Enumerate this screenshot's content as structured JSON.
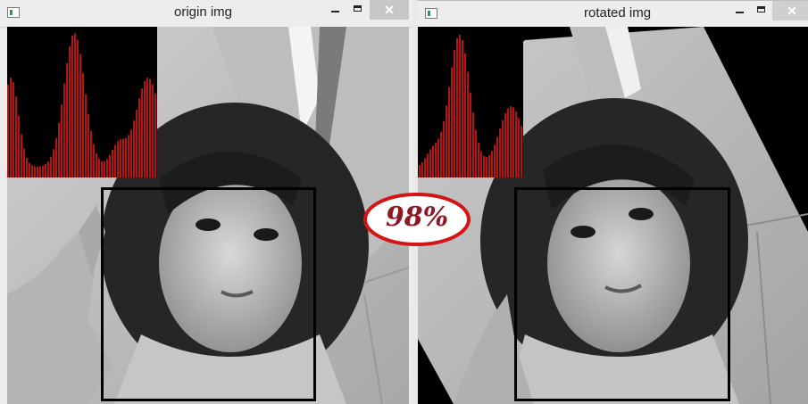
{
  "windows": {
    "left": {
      "title": "origin img",
      "close_glyph": "✕",
      "icons": {
        "system": "window-icon",
        "minimize": "minimize-icon",
        "maximize": "maximize-icon",
        "close": "close-icon"
      }
    },
    "right": {
      "title": "rotated img",
      "close_glyph": "✕",
      "icons": {
        "system": "window-icon",
        "minimize": "minimize-icon",
        "maximize": "maximize-icon",
        "close": "close-icon"
      }
    }
  },
  "overlay": {
    "match_score": "98%",
    "ring_color": "#d41515",
    "text_color": "#8b1a24"
  },
  "colors": {
    "histogram_bars": "#b01616",
    "face_box": "#000000"
  }
}
